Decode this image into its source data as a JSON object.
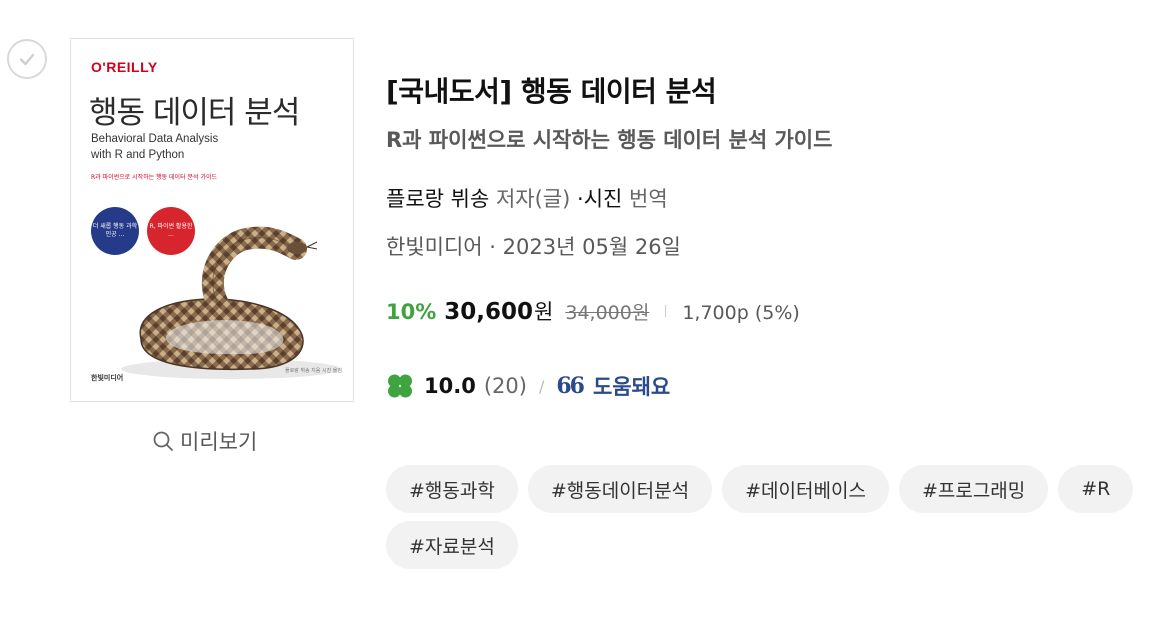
{
  "cover": {
    "publisher_logo": "O'REILLY",
    "title_ko": "행동 데이터 분석",
    "title_en_line1": "Behavioral Data Analysis",
    "title_en_line2": "with R and Python",
    "subtitle": "R과 파이썬으로 시작하는 행동 데이터 분석 가이드",
    "badge1": "더 새롭 행동 과학 인공 ...",
    "badge2": "R, 파이썬 활용한 ...",
    "imprint": "한빛미디어",
    "credit": "플로랑 뷔송 지음 시진 옮김"
  },
  "preview_label": "미리보기",
  "book": {
    "title": "[국내도서] 행동 데이터 분석",
    "subtitle": "R과 파이썬으로 시작하는 행동 데이터 분석 가이드",
    "author": "플로랑 뷔송",
    "author_role": "저자(글)",
    "translator_prefix": "·",
    "translator": "시진",
    "translator_role": "번역",
    "publisher": "한빛미디어",
    "pub_sep": "·",
    "pub_date": "2023년 05월 26일"
  },
  "price": {
    "discount": "10%",
    "sale": "30,600",
    "unit": "원",
    "original": "34,000원",
    "points": "1,700p (5%)"
  },
  "rating": {
    "score": "10.0",
    "count": "(20)",
    "slash": "/",
    "quote_mark": "66",
    "helpful": "도움돼요"
  },
  "tags": [
    "#행동과학",
    "#행동데이터분석",
    "#데이터베이스",
    "#프로그래밍",
    "#R",
    "#자료분석"
  ],
  "colors": {
    "discount": "#3fa43f",
    "helpful": "#2b4a8b",
    "tag_bg": "#f2f2f2"
  }
}
